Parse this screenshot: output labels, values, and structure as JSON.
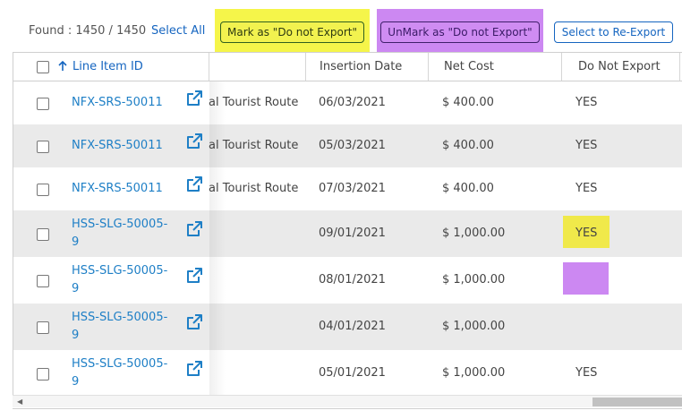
{
  "toolbar": {
    "found_label": "Found : 1450 / 1450",
    "select_all_label": "Select All",
    "mark_label": "Mark as \"Do not Export\"",
    "unmark_label": "UnMark as \"Do not Export\"",
    "reexport_label": "Select to Re-Export"
  },
  "table": {
    "headers": {
      "line_item_id": "Line Item ID",
      "insertion_date": "Insertion Date",
      "net_cost": "Net Cost",
      "do_not_export": "Do Not Export"
    },
    "rows": [
      {
        "id": "NFX-SRS-50011",
        "route": "al Tourist Route",
        "date": "06/03/2021",
        "cost": "$ 400.00",
        "dne": "YES"
      },
      {
        "id": "NFX-SRS-50011",
        "route": "al Tourist Route",
        "date": "05/03/2021",
        "cost": "$ 400.00",
        "dne": "YES"
      },
      {
        "id": "NFX-SRS-50011",
        "route": "al Tourist Route",
        "date": "07/03/2021",
        "cost": "$ 400.00",
        "dne": "YES"
      },
      {
        "id_line1": "HSS-SLG-50005-",
        "id_line2": "9",
        "route": "",
        "date": "09/01/2021",
        "cost": "$ 1,000.00",
        "dne": "YES"
      },
      {
        "id_line1": "HSS-SLG-50005-",
        "id_line2": "9",
        "route": "",
        "date": "08/01/2021",
        "cost": "$ 1,000.00",
        "dne": ""
      },
      {
        "id_line1": "HSS-SLG-50005-",
        "id_line2": "9",
        "route": "",
        "date": "04/01/2021",
        "cost": "$ 1,000.00",
        "dne": ""
      },
      {
        "id_line1": "HSS-SLG-50005-",
        "id_line2": "9",
        "route": "",
        "date": "05/01/2021",
        "cost": "$ 1,000.00",
        "dne": "YES"
      }
    ]
  },
  "icons": {
    "sort": "arrow-up-icon",
    "external": "external-link-icon",
    "scroll_left": "caret-left-icon"
  },
  "colors": {
    "accent": "#1565c0",
    "link": "#1e7fc6",
    "highlight_yellow": "#f5f54a",
    "highlight_purple": "#cc88f2",
    "alt_row": "#eaeaea"
  }
}
